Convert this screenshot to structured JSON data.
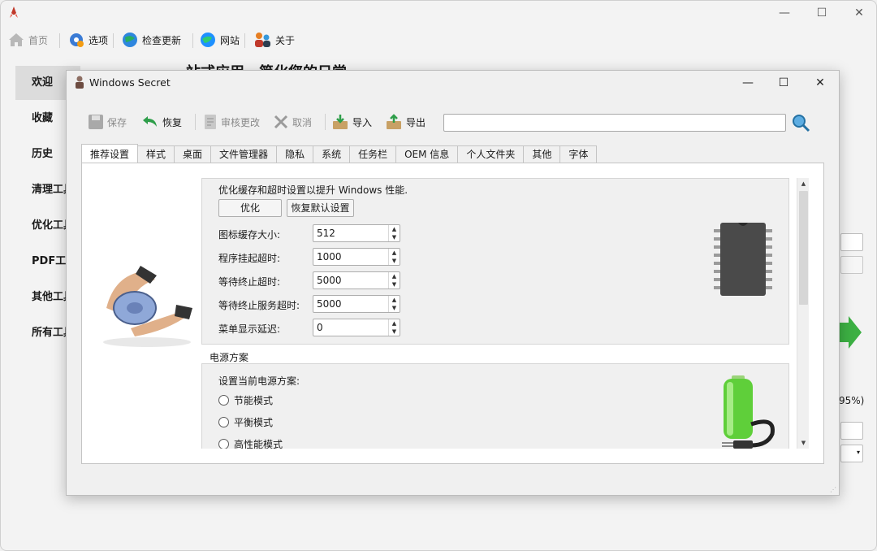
{
  "main": {
    "toolbar": [
      {
        "label": "首页",
        "icon": "home-icon"
      },
      {
        "label": "选项",
        "icon": "options-gear-icon"
      },
      {
        "label": "检查更新",
        "icon": "globe-update-icon"
      },
      {
        "label": "网站",
        "icon": "website-globe-icon"
      },
      {
        "label": "关于",
        "icon": "about-people-icon"
      }
    ],
    "sidebar": [
      {
        "label": "欢迎"
      },
      {
        "label": "收藏"
      },
      {
        "label": "历史"
      },
      {
        "label": "清理工具"
      },
      {
        "label": "优化工具"
      },
      {
        "label": "PDF工具"
      },
      {
        "label": "其他工具"
      },
      {
        "label": "所有工具"
      }
    ],
    "heading": "一站式应用，简化您的日常",
    "percent_text": "95%)"
  },
  "dialog": {
    "title": "Windows Secret",
    "toolbar": {
      "save": "保存",
      "restore": "恢复",
      "review": "审核更改",
      "cancel": "取消",
      "import": "导入",
      "export": "导出"
    },
    "search_value": "",
    "tabs": [
      "推荐设置",
      "样式",
      "桌面",
      "文件管理器",
      "隐私",
      "系统",
      "任务栏",
      "OEM 信息",
      "个人文件夹",
      "其他",
      "字体"
    ],
    "active_tab": "推荐设置",
    "cache_section": {
      "description": "优化缓存和超时设置以提升 Windows 性能.",
      "optimize_button": "优化",
      "reset_button": "恢复默认设置",
      "fields": [
        {
          "label": "图标缓存大小:",
          "value": "512"
        },
        {
          "label": "程序挂起超时:",
          "value": "1000"
        },
        {
          "label": "等待终止超时:",
          "value": "5000"
        },
        {
          "label": "等待终止服务超时:",
          "value": "5000"
        },
        {
          "label": "菜单显示延迟:",
          "value": "0"
        }
      ]
    },
    "power_section": {
      "title": "电源方案",
      "description": "设置当前电源方案:",
      "options": [
        "节能模式",
        "平衡模式",
        "高性能模式"
      ]
    }
  },
  "colors": {
    "accent_green": "#3cb043",
    "chip_dark": "#4a4a4a",
    "battery_green": "#5fcf3a"
  }
}
